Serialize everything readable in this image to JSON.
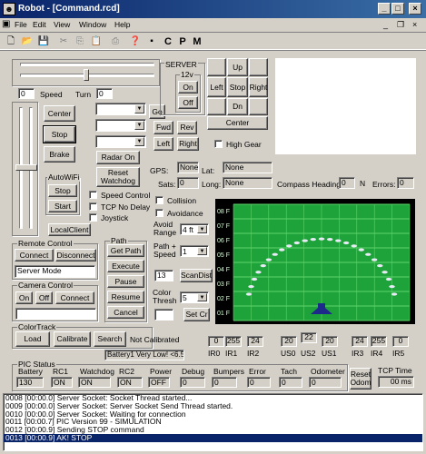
{
  "window": {
    "title": "Robot - [Command.rcd]",
    "app_icon": "robot-icon"
  },
  "menu": [
    "File",
    "Edit",
    "View",
    "Window",
    "Help"
  ],
  "toolbar": {
    "letters": [
      "C",
      "P",
      "M"
    ]
  },
  "speed": {
    "label": "Speed",
    "value": "0",
    "turn_label": "Turn",
    "turn_value": "0"
  },
  "server": {
    "label": "SERVER",
    "volt_label": "12v",
    "on": "On",
    "off": "Off"
  },
  "drive": {
    "up": "Up",
    "left": "Left",
    "stop": "Stop",
    "right": "Right",
    "dn": "Dn",
    "center": "Center",
    "high_gear": "High Gear"
  },
  "left_controls": {
    "center": "Center",
    "stop": "Stop",
    "brake": "Brake"
  },
  "commands": {
    "go": "Go",
    "fwd": "Fwd",
    "rev": "Rev",
    "left": "Left",
    "right": "Right",
    "radar_on": "Radar On",
    "reset_watchdog": "Reset Watchdog"
  },
  "autowifi": {
    "label": "AutoWiFi",
    "stop": "Stop",
    "start": "Start"
  },
  "checks": {
    "speed_control": "Speed Control",
    "tcp_no_delay": "TCP No Delay",
    "joystick": "Joystick",
    "collision": "Collision",
    "avoidance": "Avoidance"
  },
  "local_client": "LocalClient",
  "gps": {
    "gps_label": "GPS:",
    "gps_value": "None",
    "lat_label": "Lat:",
    "lat_value": "None",
    "sats_label": "Sats:",
    "sats_value": "0",
    "long_label": "Long:",
    "long_value": "None",
    "compass_label": "Compass Heading:",
    "compass_value": "0",
    "n_label": "N",
    "errors_label": "Errors:",
    "errors_value": "0"
  },
  "remote": {
    "label": "Remote Control",
    "connect": "Connect",
    "disconnect": "Disconnect",
    "mode": "Server Mode"
  },
  "path": {
    "label": "Path",
    "get_path": "Get Path",
    "execute": "Execute",
    "pause": "Pause",
    "resume": "Resume",
    "cancel": "Cancel"
  },
  "avoid": {
    "range_label": "Avoid Range",
    "range_value": "4 ft",
    "path_speed_label": "Path + Speed",
    "path_speed_value": "1",
    "scan_value": "13",
    "scan_dist": "ScanDist",
    "color_thresh_label": "Color Thresh",
    "color_thresh_value": "5",
    "set_cr": "Set Cr"
  },
  "camera": {
    "label": "Camera Control",
    "on": "On",
    "off": "Off",
    "connect": "Connect"
  },
  "colortrack": {
    "label": "ColorTrack",
    "load": "Load",
    "calibrate": "Calibrate",
    "search": "Search",
    "status": "Not Calibrated"
  },
  "battery_msg": "Battery1 Very Low! <6.5v",
  "radar": {
    "ticks": [
      "08 F",
      "07 F",
      "06 F",
      "05 F",
      "04 F",
      "03 F",
      "02 F",
      "01 F"
    ],
    "arc_count": 25
  },
  "sensors": [
    {
      "name": "IR0",
      "value": "0"
    },
    {
      "name": "IR1",
      "value": "255"
    },
    {
      "name": "IR2",
      "value": "24"
    },
    {
      "name": "US0",
      "value": "20"
    },
    {
      "name": "US2",
      "value": "22"
    },
    {
      "name": "US1",
      "value": "20"
    },
    {
      "name": "IR3",
      "value": "24"
    },
    {
      "name": "IR4",
      "value": "255"
    },
    {
      "name": "IR5",
      "value": "0"
    }
  ],
  "pic": {
    "label": "PIC Status",
    "fields": [
      {
        "name": "Battery",
        "value": "130"
      },
      {
        "name": "RC1",
        "value": "ON"
      },
      {
        "name": "Watchdog",
        "value": "ON"
      },
      {
        "name": "RC2",
        "value": "ON"
      },
      {
        "name": "Power",
        "value": "OFF"
      },
      {
        "name": "Debug",
        "value": "0"
      },
      {
        "name": "Bumpers",
        "value": "0"
      },
      {
        "name": "Error",
        "value": "0"
      },
      {
        "name": "Tach",
        "value": "0"
      },
      {
        "name": "Odometer",
        "value": "0"
      }
    ],
    "reset_odom": "Reset Odom",
    "tcp_time_label": "TCP Time",
    "tcp_time_value": "00 ms"
  },
  "log": [
    "0008 [00:00.0] Server Socket: Socket Thread started...",
    "0009 [00:00.0] Server Socket: Server Socket Send Thread started.",
    "0010 [00:00.0] Server Socket: Waiting for connection",
    "0011 [00:00.7] PIC Version 99 - SIMULATION",
    "0012 [00:00.9] Sending STOP command",
    "0013 [00:00.9] AK! STOP"
  ],
  "colors": {
    "radar_bg": "#000000",
    "radar_green": "#1ea33a",
    "radar_grid": "#5ed36a",
    "arc_dot": "#e8eaf5",
    "robot": "#1e2a8a",
    "title_left": "#0a246a",
    "title_right": "#3a6ea5"
  }
}
